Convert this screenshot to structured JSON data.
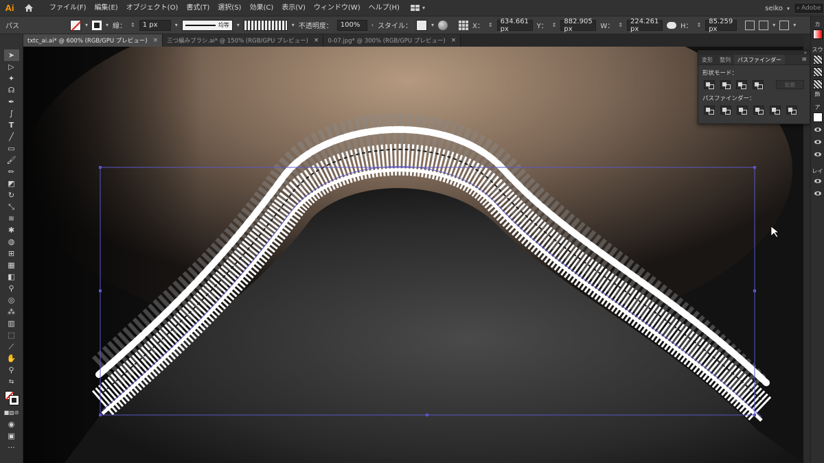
{
  "app": {
    "logo": "Ai"
  },
  "menu": {
    "items": [
      "ファイル(F)",
      "編集(E)",
      "オブジェクト(O)",
      "書式(T)",
      "選択(S)",
      "効果(C)",
      "表示(V)",
      "ウィンドウ(W)",
      "ヘルプ(H)"
    ],
    "user": "seiko",
    "search_placeholder": "Adobe"
  },
  "control": {
    "selection_type": "パス",
    "stroke_label": "線：",
    "stroke_weight": "1 px",
    "stroke_profile": "均等",
    "opacity_label": "不透明度：",
    "opacity": "100%",
    "style_label": "スタイル：",
    "x_label": "X：",
    "x": "634.661 px",
    "y_label": "Y：",
    "y": "882.905 px",
    "w_label": "W：",
    "w": "224.261 px",
    "h_label": "H：",
    "h": "85.259 px"
  },
  "tabs": [
    {
      "label": "txtc_ai.ai* @ 600% (RGB/GPU プレビュー)",
      "active": true
    },
    {
      "label": "三つ編みブラシ.ai* @ 150% (RGB/GPU プレビュー)",
      "active": false
    },
    {
      "label": "0-07.jpg* @ 300% (RGB/GPU プレビュー)",
      "active": false
    }
  ],
  "panel": {
    "tabs": [
      "変形",
      "整列",
      "パスファインダー"
    ],
    "shape_modes_label": "形状モード：",
    "expand_label": "拡張",
    "pathfinders_label": "パスファインダー："
  },
  "dock": {
    "items": [
      "カ",
      "スウ",
      "ア",
      "レイ"
    ],
    "thumb_label": "飾"
  },
  "colors": {
    "accent": "#ff9a00",
    "selection_box": "#5a56c8"
  }
}
